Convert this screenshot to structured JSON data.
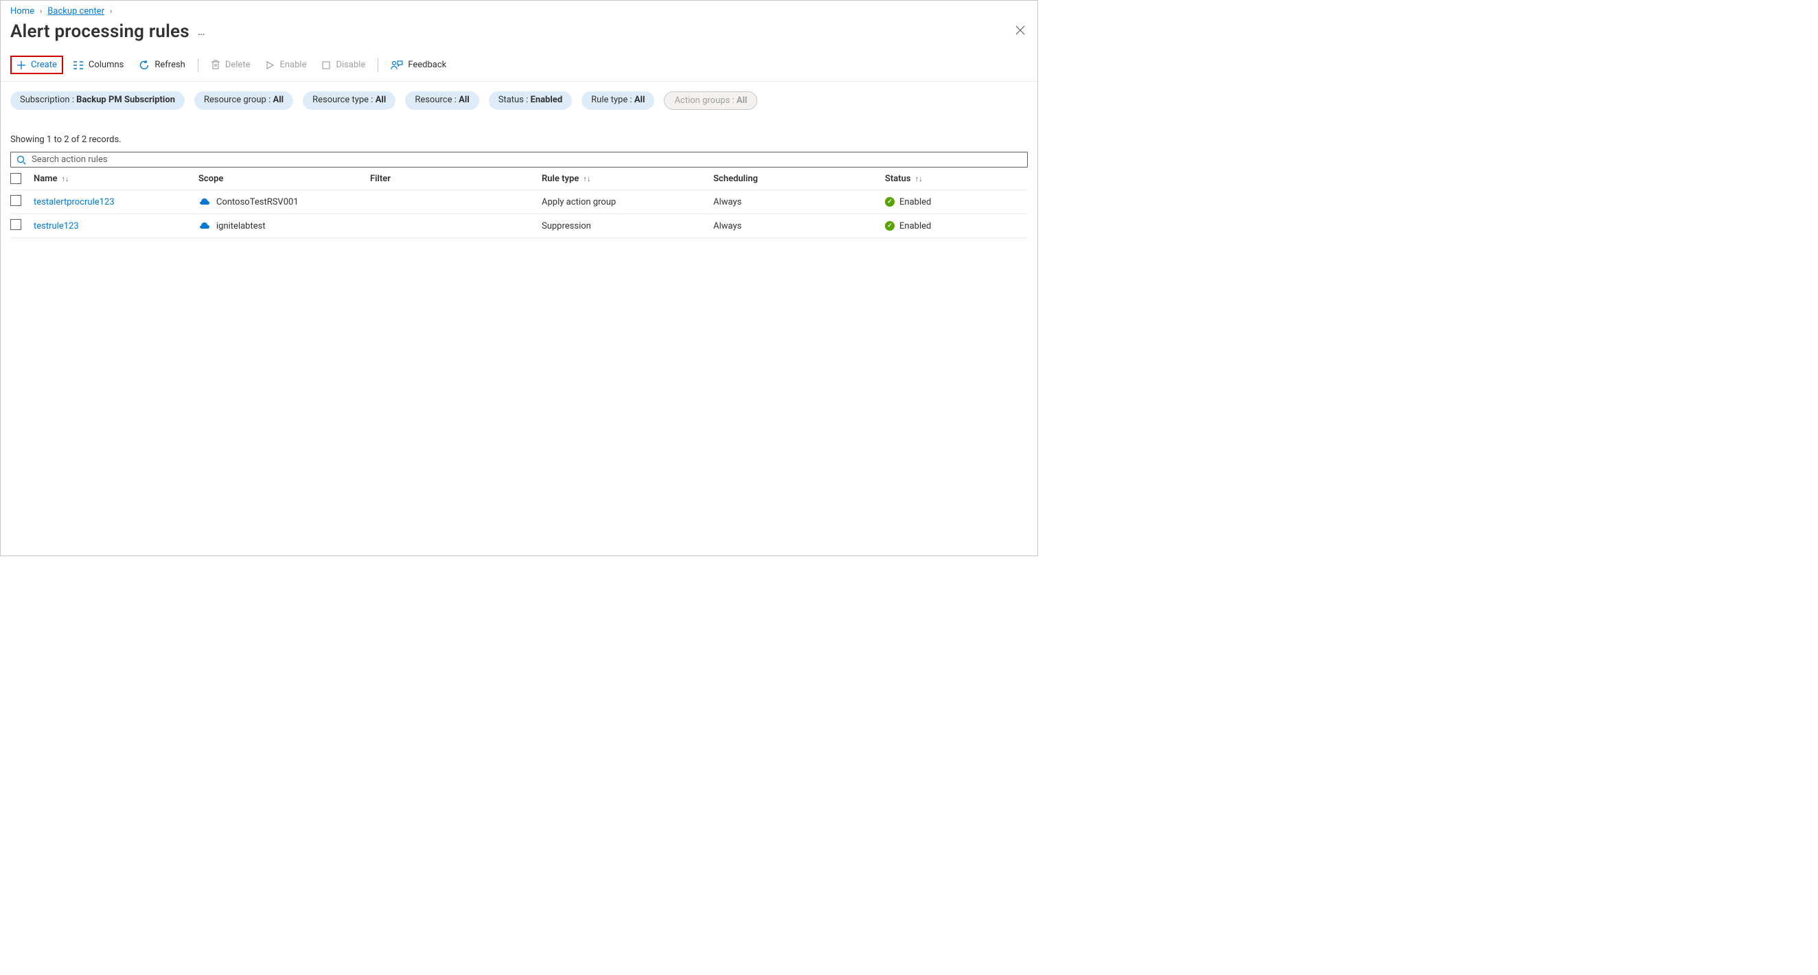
{
  "breadcrumb": {
    "home": "Home",
    "backup_center": "Backup center"
  },
  "page": {
    "title": "Alert processing rules"
  },
  "toolbar": {
    "create": "Create",
    "columns": "Columns",
    "refresh": "Refresh",
    "delete": "Delete",
    "enable": "Enable",
    "disable": "Disable",
    "feedback": "Feedback"
  },
  "filters": {
    "subscription": {
      "label": "Subscription : ",
      "value": "Backup PM Subscription"
    },
    "resource_group": {
      "label": "Resource group : ",
      "value": "All"
    },
    "resource_type": {
      "label": "Resource type : ",
      "value": "All"
    },
    "resource": {
      "label": "Resource : ",
      "value": "All"
    },
    "status": {
      "label": "Status : ",
      "value": "Enabled"
    },
    "rule_type": {
      "label": "Rule type : ",
      "value": "All"
    },
    "action_groups": {
      "label": "Action groups : ",
      "value": "All"
    }
  },
  "records_line": "Showing 1 to 2 of 2 records.",
  "search": {
    "placeholder": "Search action rules"
  },
  "columns": {
    "name": "Name",
    "scope": "Scope",
    "filter": "Filter",
    "ruletype": "Rule type",
    "scheduling": "Scheduling",
    "status": "Status"
  },
  "rows": [
    {
      "name": "testalertprocrule123",
      "scope": "ContosoTestRSV001",
      "filter": "",
      "ruletype": "Apply action group",
      "scheduling": "Always",
      "status": "Enabled"
    },
    {
      "name": "testrule123",
      "scope": "ignitelabtest",
      "filter": "",
      "ruletype": "Suppression",
      "scheduling": "Always",
      "status": "Enabled"
    }
  ]
}
